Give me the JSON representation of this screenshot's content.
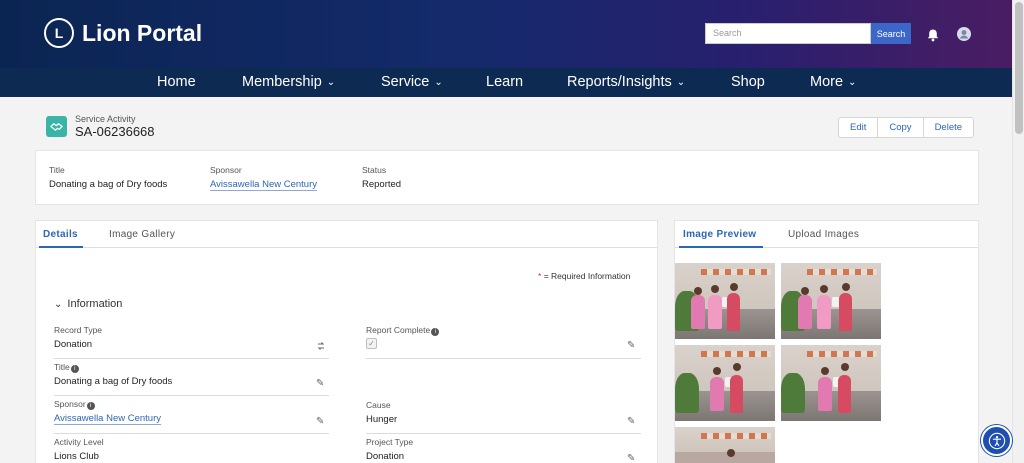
{
  "header": {
    "app_title": "Lion Portal",
    "logo_text": "LIONS",
    "search_placeholder": "Search",
    "search_button": "Search"
  },
  "nav": {
    "items": [
      {
        "label": "Home",
        "has_menu": false
      },
      {
        "label": "Membership",
        "has_menu": true
      },
      {
        "label": "Service",
        "has_menu": true
      },
      {
        "label": "Learn",
        "has_menu": false
      },
      {
        "label": "Reports/Insights",
        "has_menu": true
      },
      {
        "label": "Shop",
        "has_menu": false
      },
      {
        "label": "More",
        "has_menu": true
      }
    ]
  },
  "record": {
    "object_type": "Service Activity",
    "name": "SA-06236668",
    "actions": [
      "Edit",
      "Copy",
      "Delete"
    ]
  },
  "highlights": {
    "title_label": "Title",
    "title_value": "Donating a bag of Dry foods",
    "sponsor_label": "Sponsor",
    "sponsor_value": "Avissawella New Century",
    "status_label": "Status",
    "status_value": "Reported"
  },
  "details": {
    "tabs": [
      "Details",
      "Image Gallery"
    ],
    "required_star": "*",
    "required_text": "= Required Information",
    "section_title": "Information",
    "fields": {
      "record_type_label": "Record Type",
      "record_type_value": "Donation",
      "report_complete_label": "Report Complete",
      "report_complete_checked": true,
      "title_label": "Title",
      "title_value": "Donating a bag of Dry foods",
      "sponsor_label": "Sponsor",
      "sponsor_value": "Avissawella New Century",
      "cause_label": "Cause",
      "cause_value": "Hunger",
      "activity_level_label": "Activity Level",
      "activity_level_value": "Lions Club",
      "project_type_label": "Project Type",
      "project_type_value": "Donation"
    }
  },
  "images": {
    "tabs": [
      "Image Preview",
      "Upload Images"
    ],
    "thumbnail_count": 5
  },
  "colors": {
    "accent": "#2c66b8",
    "nav_bg": "#0d2b52",
    "record_icon": "#3bb4a8"
  }
}
